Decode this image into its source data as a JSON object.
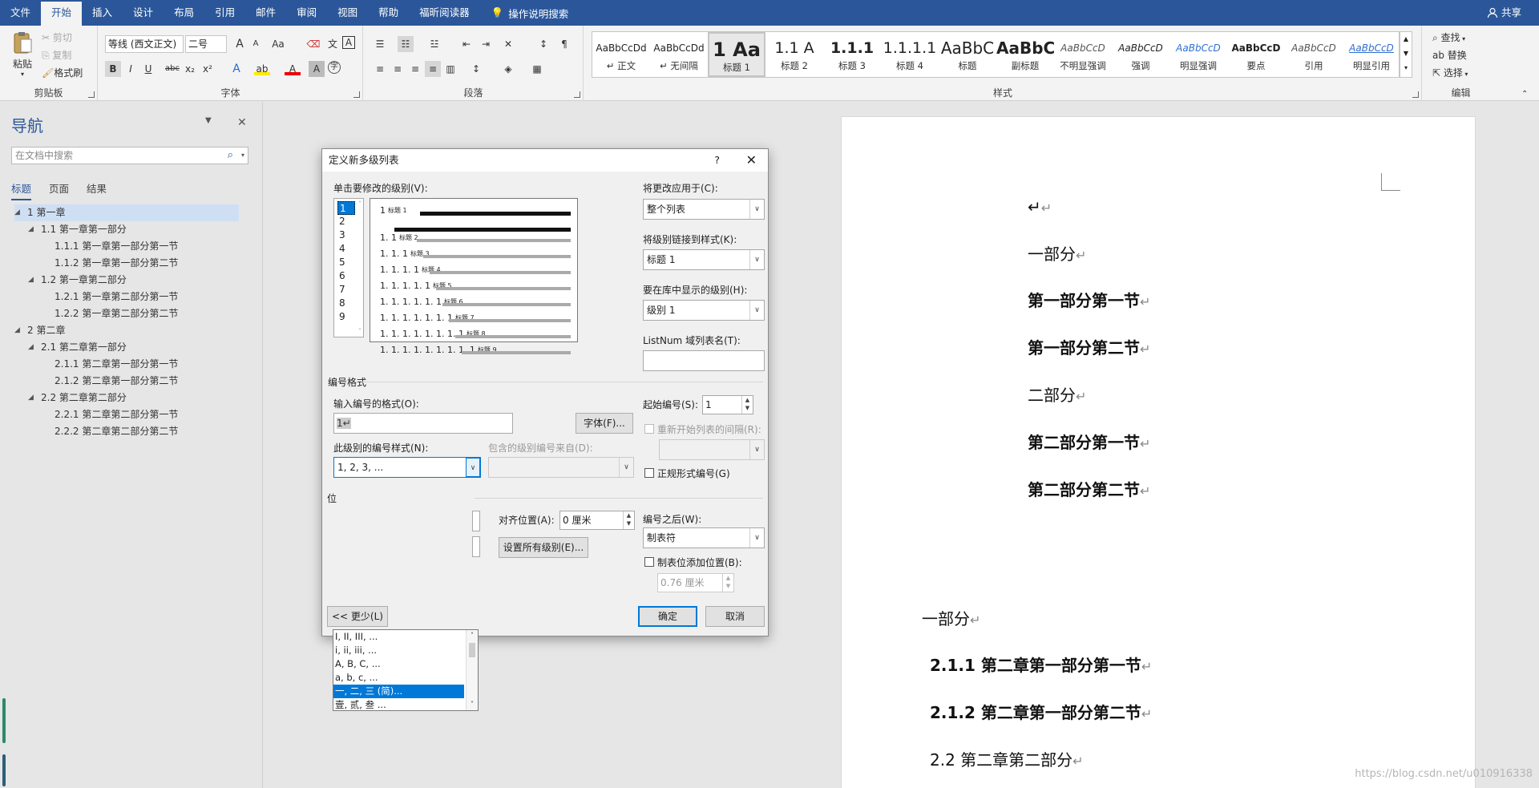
{
  "menu": {
    "items": [
      "文件",
      "开始",
      "插入",
      "设计",
      "布局",
      "引用",
      "邮件",
      "审阅",
      "视图",
      "帮助",
      "福昕阅读器"
    ],
    "tell_me": "操作说明搜索",
    "share": "共享"
  },
  "ribbon": {
    "clipboard": {
      "paste": "粘贴",
      "cut": "剪切",
      "copy": "复制",
      "format_painter": "格式刷",
      "label": "剪贴板"
    },
    "font": {
      "name": "等线 (西文正文)",
      "size": "二号",
      "label": "字体",
      "bold": "B",
      "italic": "I",
      "underline": "U",
      "strike": "abc",
      "sub": "x₂",
      "sup": "x²",
      "grow": "A",
      "shrink": "A",
      "case": "Aa"
    },
    "paragraph": {
      "label": "段落"
    },
    "styles": {
      "label": "样式",
      "items": [
        {
          "preview": "AaBbCcDd",
          "name": "↵ 正文"
        },
        {
          "preview": "AaBbCcDd",
          "name": "↵ 无间隔"
        },
        {
          "preview": "1  Aa",
          "name": "标题 1"
        },
        {
          "preview": "1.1  A",
          "name": "标题 2"
        },
        {
          "preview": "1.1.1",
          "name": "标题 3"
        },
        {
          "preview": "1.1.1.1",
          "name": "标题 4"
        },
        {
          "preview": "AaBbC",
          "name": "标题"
        },
        {
          "preview": "AaBbC",
          "name": "副标题"
        },
        {
          "preview": "AaBbCcD",
          "name": "不明显强调"
        },
        {
          "preview": "AaBbCcD",
          "name": "强调"
        },
        {
          "preview": "AaBbCcD",
          "name": "明显强调"
        },
        {
          "preview": "AaBbCcD",
          "name": "要点"
        },
        {
          "preview": "AaBbCcD",
          "name": "引用"
        },
        {
          "preview": "AaBbCcD",
          "name": "明显引用"
        }
      ]
    },
    "editing": {
      "find": "查找",
      "replace": "替换",
      "select": "选择",
      "label": "编辑"
    }
  },
  "nav": {
    "title": "导航",
    "search_placeholder": "在文档中搜索",
    "tabs": [
      "标题",
      "页面",
      "结果"
    ],
    "tree": [
      {
        "text": "1 第一章",
        "level": 0,
        "selected": true
      },
      {
        "text": "1.1 第一章第一部分",
        "level": 1
      },
      {
        "text": "1.1.1 第一章第一部分第一节",
        "level": 2
      },
      {
        "text": "1.1.2 第一章第一部分第二节",
        "level": 2
      },
      {
        "text": "1.2 第一章第二部分",
        "level": 1
      },
      {
        "text": "1.2.1 第一章第二部分第一节",
        "level": 2
      },
      {
        "text": "1.2.2 第一章第二部分第二节",
        "level": 2
      },
      {
        "text": "2 第二章",
        "level": 0
      },
      {
        "text": "2.1 第二章第一部分",
        "level": 1
      },
      {
        "text": "2.1.1 第二章第一部分第一节",
        "level": 2
      },
      {
        "text": "2.1.2 第二章第一部分第二节",
        "level": 2
      },
      {
        "text": "2.2 第二章第二部分",
        "level": 1
      },
      {
        "text": "2.2.1 第二章第二部分第一节",
        "level": 2
      },
      {
        "text": "2.2.2 第二章第二部分第二节",
        "level": 2
      }
    ]
  },
  "document": {
    "lines": [
      {
        "text": "↵",
        "bold": false
      },
      {
        "text": "一部分",
        "bold": false
      },
      {
        "text": "第一部分第一节",
        "bold": true
      },
      {
        "text": "第一部分第二节",
        "bold": true
      },
      {
        "text": "二部分",
        "bold": false
      },
      {
        "text": "第二部分第一节",
        "bold": true
      },
      {
        "text": "第二部分第二节",
        "bold": true
      },
      {
        "text": "一部分",
        "bold": false
      },
      {
        "text": "2.1.1 第二章第一部分第一节",
        "bold": true
      },
      {
        "text": "2.1.2 第二章第一部分第二节",
        "bold": true
      },
      {
        "text": "2.2  第二章第二部分",
        "bold": false
      }
    ],
    "watermark": "https://blog.csdn.net/u010916338"
  },
  "dialog": {
    "title": "定义新多级列表",
    "help": "?",
    "close": "✕",
    "click_level_label": "单击要修改的级别(V):",
    "levels": [
      "1",
      "2",
      "3",
      "4",
      "5",
      "6",
      "7",
      "8",
      "9"
    ],
    "preview_rows": [
      {
        "num": "1",
        "tag": "标题 1"
      },
      {
        "num": "1. 1",
        "tag": "标题 2"
      },
      {
        "num": "1. 1. 1",
        "tag": "标题 3"
      },
      {
        "num": "1. 1. 1. 1",
        "tag": "标题 4"
      },
      {
        "num": "1. 1. 1. 1. 1",
        "tag": "标题 5"
      },
      {
        "num": "1. 1. 1. 1. 1. 1",
        "tag": "标题 6"
      },
      {
        "num": "1. 1. 1. 1. 1. 1. 1",
        "tag": "标题 7"
      },
      {
        "num": "1. 1. 1. 1. 1. 1. 1. 1",
        "tag": "标题 8"
      },
      {
        "num": "1. 1. 1. 1. 1. 1. 1. 1. 1",
        "tag": "标题 9"
      }
    ],
    "apply_to_label": "将更改应用于(C):",
    "apply_to_value": "整个列表",
    "link_style_label": "将级别链接到样式(K):",
    "link_style_value": "标题 1",
    "gallery_level_label": "要在库中显示的级别(H):",
    "gallery_level_value": "级别 1",
    "listnum_label": "ListNum 域列表名(T):",
    "listnum_value": "",
    "number_format_section": "编号格式",
    "enter_format_label": "输入编号的格式(O):",
    "enter_format_value": "1↵",
    "font_button": "字体(F)...",
    "start_at_label": "起始编号(S):",
    "start_at_value": "1",
    "restart_label": "重新开始列表的间隔(R):",
    "number_style_label": "此级别的编号样式(N):",
    "number_style_value": "1, 2, 3, ...",
    "include_level_label": "包含的级别编号来自(D):",
    "legal_label": "正规形式编号(G)",
    "style_options": [
      "I, II, III, ...",
      "i, ii, iii, ...",
      "A, B, C, ...",
      "a, b, c, ...",
      "一, 二, 三 (简)...",
      "壹, 贰, 叁 ..."
    ],
    "style_selected_index": 4,
    "position_section": "位",
    "align_at_label": "对齐位置(A):",
    "align_at_value": "0 厘米",
    "set_all_button": "设置所有级别(E)...",
    "follow_label": "编号之后(W):",
    "follow_value": "制表符",
    "tab_add_label": "制表位添加位置(B):",
    "tab_add_value": "0.76 厘米",
    "less_button": "<< 更少(L)",
    "ok_button": "确定",
    "cancel_button": "取消"
  }
}
